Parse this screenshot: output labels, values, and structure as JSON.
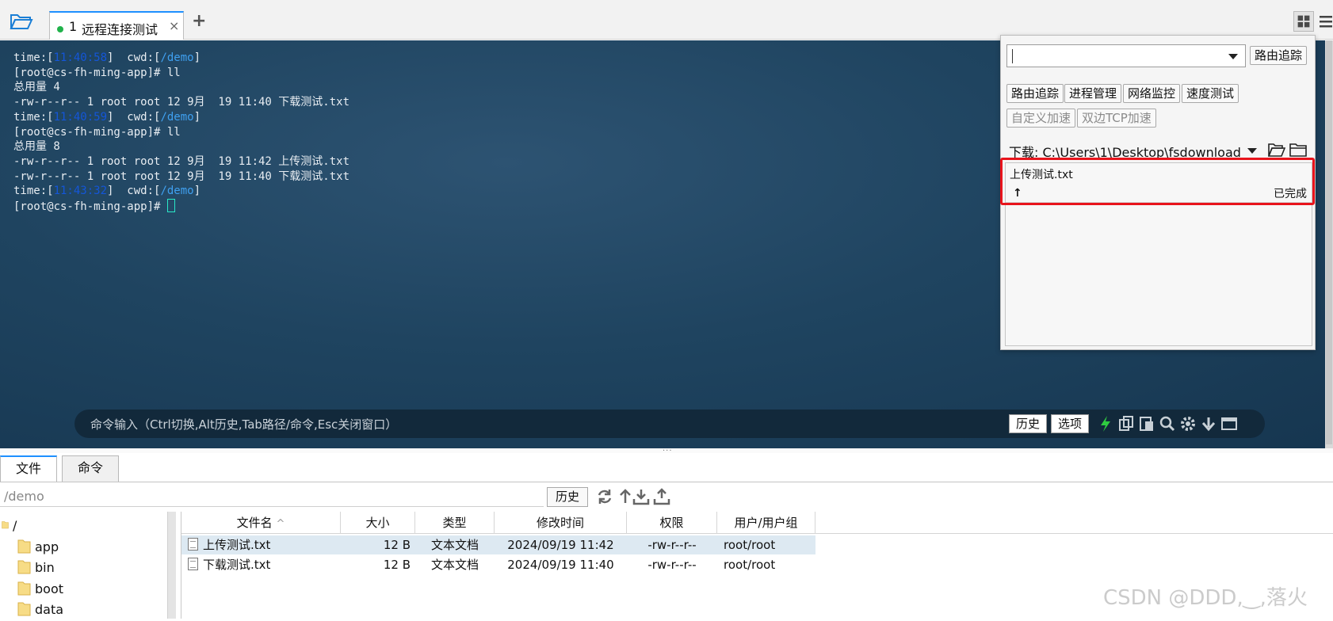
{
  "window": {
    "tab": {
      "number": "1",
      "title": "远程连接测试",
      "close": "×"
    },
    "add_tab": "+"
  },
  "terminal": {
    "lines": [
      {
        "kind": "time",
        "prefix": "time:[",
        "time": "11:40:58",
        "mid": "]  cwd:[",
        "cwd": "/demo",
        "suffix": "]"
      },
      {
        "kind": "text",
        "text": "[root@cs-fh-ming-app]# ll"
      },
      {
        "kind": "text",
        "text": "总用量 4"
      },
      {
        "kind": "text",
        "text": "-rw-r--r-- 1 root root 12 9月  19 11:40 下载测试.txt"
      },
      {
        "kind": "time",
        "prefix": "time:[",
        "time": "11:40:59",
        "mid": "]  cwd:[",
        "cwd": "/demo",
        "suffix": "]"
      },
      {
        "kind": "text",
        "text": "[root@cs-fh-ming-app]# ll"
      },
      {
        "kind": "text",
        "text": "总用量 8"
      },
      {
        "kind": "text",
        "text": "-rw-r--r-- 1 root root 12 9月  19 11:42 上传测试.txt"
      },
      {
        "kind": "text",
        "text": "-rw-r--r-- 1 root root 12 9月  19 11:40 下载测试.txt"
      },
      {
        "kind": "time",
        "prefix": "time:[",
        "time": "11:43:32",
        "mid": "]  cwd:[",
        "cwd": "/demo",
        "suffix": "]"
      },
      {
        "kind": "prompt",
        "text": "[root@cs-fh-ming-app]# "
      }
    ],
    "command_bar": {
      "placeholder": "命令输入（Ctrl切换,Alt历史,Tab路径/命令,Esc关闭窗口）",
      "history": "历史",
      "options": "选项"
    }
  },
  "panel": {
    "route_select_value": "",
    "route_trace_button": "路由追踪",
    "tools": [
      "路由追踪",
      "进程管理",
      "网络监控",
      "速度测试"
    ],
    "tools_disabled": [
      "自定义加速",
      "双边TCP加速"
    ],
    "download_path": "下载: C:\\Users\\1\\Desktop\\fsdownload",
    "transfer": {
      "file": "上传测试.txt",
      "direction": "↑",
      "status": "已完成"
    }
  },
  "file_manager": {
    "tabs": [
      "文件",
      "命令"
    ],
    "path": "/demo",
    "history": "历史",
    "tree": [
      {
        "name": "/",
        "level": 0
      },
      {
        "name": "app",
        "level": 1
      },
      {
        "name": "bin",
        "level": 1
      },
      {
        "name": "boot",
        "level": 1
      },
      {
        "name": "data",
        "level": 1
      }
    ],
    "columns": [
      "文件名",
      "大小",
      "类型",
      "修改时间",
      "权限",
      "用户/用户组"
    ],
    "sort_indicator": "^",
    "files": [
      {
        "name": "上传测试.txt",
        "size": "12 B",
        "type": "文本文档",
        "mtime": "2024/09/19 11:42",
        "perm": "-rw-r--r--",
        "owner": "root/root",
        "selected": true
      },
      {
        "name": "下载测试.txt",
        "size": "12 B",
        "type": "文本文档",
        "mtime": "2024/09/19 11:40",
        "perm": "-rw-r--r--",
        "owner": "root/root",
        "selected": false
      }
    ]
  },
  "watermark": "CSDN @DDD,‿,落火",
  "colors": {
    "accent": "#1e90ff",
    "status_dot": "#21b24b",
    "highlight": "#e8141c",
    "time_text": "#1456d8",
    "cwd_text": "#3fa0f0"
  }
}
